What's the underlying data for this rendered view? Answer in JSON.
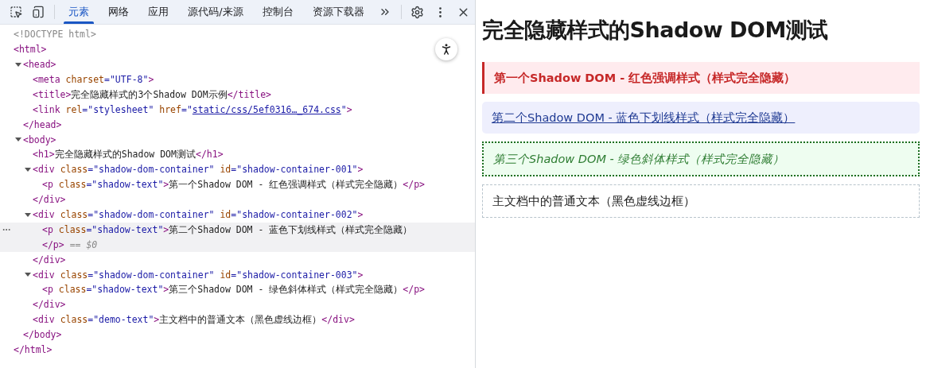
{
  "devtools": {
    "tabs": [
      {
        "label": "元素",
        "selected": true
      },
      {
        "label": "网络",
        "selected": false
      },
      {
        "label": "应用",
        "selected": false
      },
      {
        "label": "源代码/来源",
        "selected": false
      },
      {
        "label": "控制台",
        "selected": false
      },
      {
        "label": "资源下载器",
        "selected": false
      }
    ],
    "tree": [
      {
        "line": [
          {
            "kind": "doctype",
            "text": "<!DOCTYPE html>"
          }
        ]
      },
      {
        "line": [
          {
            "kind": "tag",
            "text": "<html>"
          }
        ],
        "close": [
          {
            "kind": "tag",
            "text": "</html>"
          }
        ],
        "children": [
          {
            "expanded": true,
            "line": [
              {
                "kind": "tag",
                "text": "<head>"
              }
            ],
            "close": [
              {
                "kind": "tag",
                "text": "</head>"
              }
            ],
            "children": [
              {
                "line": [
                  {
                    "kind": "tag",
                    "text": "<meta"
                  },
                  {
                    "kind": "attr",
                    "text": " charset"
                  },
                  {
                    "kind": "value",
                    "text": "=\"UTF-8\""
                  },
                  {
                    "kind": "tag",
                    "text": ">"
                  }
                ]
              },
              {
                "line": [
                  {
                    "kind": "tag",
                    "text": "<title>"
                  },
                  {
                    "kind": "text",
                    "text": "完全隐藏样式的3个Shadow DOM示例"
                  },
                  {
                    "kind": "tag",
                    "text": "</title>"
                  }
                ]
              },
              {
                "line": [
                  {
                    "kind": "tag",
                    "text": "<link"
                  },
                  {
                    "kind": "attr",
                    "text": " rel"
                  },
                  {
                    "kind": "value",
                    "text": "=\"stylesheet\""
                  },
                  {
                    "kind": "attr",
                    "text": " href"
                  },
                  {
                    "kind": "value",
                    "text": "=\""
                  },
                  {
                    "kind": "link",
                    "text": "static/css/5ef0316…_674.css"
                  },
                  {
                    "kind": "value",
                    "text": "\""
                  },
                  {
                    "kind": "tag",
                    "text": ">"
                  }
                ]
              }
            ]
          },
          {
            "expanded": true,
            "line": [
              {
                "kind": "tag",
                "text": "<body>"
              }
            ],
            "close": [
              {
                "kind": "tag",
                "text": "</body>"
              }
            ],
            "children": [
              {
                "line": [
                  {
                    "kind": "tag",
                    "text": "<h1>"
                  },
                  {
                    "kind": "text",
                    "text": "完全隐藏样式的Shadow DOM测试"
                  },
                  {
                    "kind": "tag",
                    "text": "</h1>"
                  }
                ]
              },
              {
                "expanded": true,
                "line": [
                  {
                    "kind": "tag",
                    "text": "<div"
                  },
                  {
                    "kind": "attr",
                    "text": " class"
                  },
                  {
                    "kind": "value",
                    "text": "=\"shadow-dom-container\""
                  },
                  {
                    "kind": "attr",
                    "text": " id"
                  },
                  {
                    "kind": "value",
                    "text": "=\"shadow-container-001\""
                  },
                  {
                    "kind": "tag",
                    "text": ">"
                  }
                ],
                "close": [
                  {
                    "kind": "tag",
                    "text": "</div>"
                  }
                ],
                "children": [
                  {
                    "line": [
                      {
                        "kind": "tag",
                        "text": "<p"
                      },
                      {
                        "kind": "attr",
                        "text": " class"
                      },
                      {
                        "kind": "value",
                        "text": "=\"shadow-text\""
                      },
                      {
                        "kind": "tag",
                        "text": ">"
                      },
                      {
                        "kind": "text",
                        "text": "第一个Shadow DOM - 红色强调样式（样式完全隐藏）"
                      },
                      {
                        "kind": "tag",
                        "text": "</p>"
                      }
                    ]
                  }
                ]
              },
              {
                "expanded": true,
                "line": [
                  {
                    "kind": "tag",
                    "text": "<div"
                  },
                  {
                    "kind": "attr",
                    "text": " class"
                  },
                  {
                    "kind": "value",
                    "text": "=\"shadow-dom-container\""
                  },
                  {
                    "kind": "attr",
                    "text": " id"
                  },
                  {
                    "kind": "value",
                    "text": "=\"shadow-container-002\""
                  },
                  {
                    "kind": "tag",
                    "text": ">"
                  }
                ],
                "close": [
                  {
                    "kind": "tag",
                    "text": "</div>"
                  }
                ],
                "children": [
                  {
                    "selected": true,
                    "line": [
                      {
                        "kind": "tag",
                        "text": "<p"
                      },
                      {
                        "kind": "attr",
                        "text": " class"
                      },
                      {
                        "kind": "value",
                        "text": "=\"shadow-text\""
                      },
                      {
                        "kind": "tag",
                        "text": ">"
                      },
                      {
                        "kind": "text",
                        "text": "第二个Shadow DOM - 蓝色下划线样式（样式完全隐藏）"
                      }
                    ],
                    "close": [
                      {
                        "kind": "tag",
                        "text": "</p>"
                      },
                      {
                        "kind": "comment",
                        "text": " == $0"
                      }
                    ]
                  }
                ]
              },
              {
                "expanded": true,
                "line": [
                  {
                    "kind": "tag",
                    "text": "<div"
                  },
                  {
                    "kind": "attr",
                    "text": " class"
                  },
                  {
                    "kind": "value",
                    "text": "=\"shadow-dom-container\""
                  },
                  {
                    "kind": "attr",
                    "text": " id"
                  },
                  {
                    "kind": "value",
                    "text": "=\"shadow-container-003\""
                  },
                  {
                    "kind": "tag",
                    "text": ">"
                  }
                ],
                "close": [
                  {
                    "kind": "tag",
                    "text": "</div>"
                  }
                ],
                "children": [
                  {
                    "line": [
                      {
                        "kind": "tag",
                        "text": "<p"
                      },
                      {
                        "kind": "attr",
                        "text": " class"
                      },
                      {
                        "kind": "value",
                        "text": "=\"shadow-text\""
                      },
                      {
                        "kind": "tag",
                        "text": ">"
                      },
                      {
                        "kind": "text",
                        "text": "第三个Shadow DOM - 绿色斜体样式（样式完全隐藏）"
                      },
                      {
                        "kind": "tag",
                        "text": "</p>"
                      }
                    ]
                  }
                ]
              },
              {
                "line": [
                  {
                    "kind": "tag",
                    "text": "<div"
                  },
                  {
                    "kind": "attr",
                    "text": " class"
                  },
                  {
                    "kind": "value",
                    "text": "=\"demo-text\""
                  },
                  {
                    "kind": "tag",
                    "text": ">"
                  },
                  {
                    "kind": "text",
                    "text": "主文档中的普通文本（黑色虚线边框）"
                  },
                  {
                    "kind": "tag",
                    "text": "</div>"
                  }
                ]
              }
            ]
          }
        ]
      }
    ]
  },
  "page": {
    "heading": "完全隐藏样式的Shadow DOM测试",
    "blocks": [
      {
        "kind": "red",
        "text": "第一个Shadow DOM - 红色强调样式（样式完全隐藏）"
      },
      {
        "kind": "blue",
        "text": "第二个Shadow DOM - 蓝色下划线样式（样式完全隐藏）"
      },
      {
        "kind": "green",
        "text": "第三个Shadow DOM - 绿色斜体样式（样式完全隐藏）"
      },
      {
        "kind": "plain",
        "text": "主文档中的普通文本（黑色虚线边框）"
      }
    ]
  }
}
